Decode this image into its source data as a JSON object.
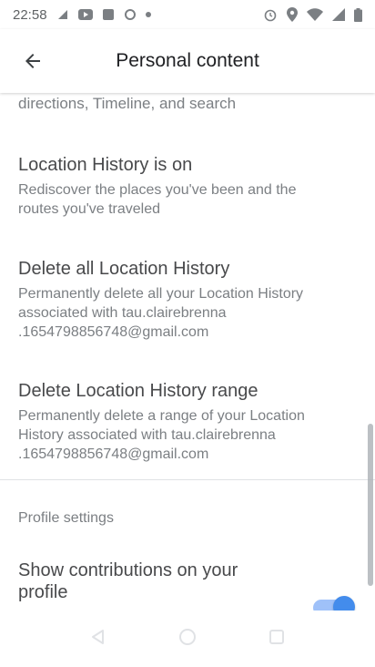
{
  "status_bar": {
    "time": "22:58",
    "left_icons": [
      "signal-icon",
      "youtube-icon",
      "gallery-icon",
      "sync-icon",
      "dot-icon"
    ],
    "right_icons": [
      "alarm-icon",
      "location-icon",
      "wifi-icon",
      "signal-icon",
      "battery-icon"
    ]
  },
  "app_bar": {
    "title": "Personal content",
    "back_icon": "arrow-back-icon"
  },
  "content": {
    "cut_line": "directions, Timeline, and search",
    "items": [
      {
        "title": "Location History is on",
        "subtitle": "Rediscover the places you've been and the routes you've traveled"
      },
      {
        "title": "Delete all Location History",
        "subtitle": "Permanently delete all your Location History associated with tau.clairebrenna .1654798856748@gmail.com"
      },
      {
        "title": "Delete Location History range",
        "subtitle": "Permanently delete a range of your Location History associated with tau.clairebrenna .1654798856748@gmail.com"
      }
    ],
    "section_header": "Profile settings",
    "toggle_row": {
      "label": "Show contributions on your profile",
      "state": "on"
    }
  },
  "colors": {
    "accent": "#1a73e8",
    "accent_track": "#8ab4f8",
    "secondary_text": "#5f6368"
  },
  "nav_bar": {
    "buttons": [
      "back-nav-icon",
      "home-nav-icon",
      "recents-nav-icon"
    ]
  }
}
